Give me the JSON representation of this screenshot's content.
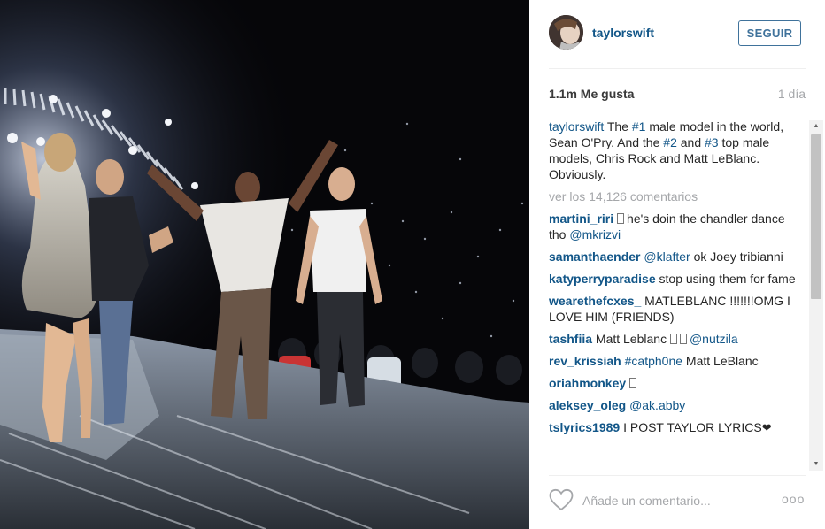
{
  "header": {
    "username": "taylorswift",
    "follow_label": "SEGUIR"
  },
  "stats": {
    "likes": "1.1m Me gusta",
    "time": "1 día"
  },
  "caption": {
    "user": "taylorswift",
    "t1": "The ",
    "tag1": "#1",
    "t2": " male model in the world, Sean O'Pry. And the ",
    "tag2": "#2",
    "t3": " and ",
    "tag3": "#3",
    "t4": " top male models, Chris Rock and Matt LeBlanc. Obviously."
  },
  "view_all": "ver los 14,126 comentarios",
  "comments": [
    {
      "user": "martini_riri",
      "text": "he's doin the chandler dance tho ",
      "tag": "@mkrizvi"
    },
    {
      "user": "samanthaender",
      "tag": "@klafter",
      "text": " ok Joey tribianni"
    },
    {
      "user": "katyperryparadise",
      "text": " stop using them for fame"
    },
    {
      "user": "wearethefcxes_",
      "text": " MATLEBLANC !!!!!!!OMG I LOVE HIM (FRIENDS)"
    },
    {
      "user": "tashfiia",
      "text": " Matt Leblanc ",
      "tag": "@nutzila"
    },
    {
      "user": "rev_krissiah",
      "tag": "#catph0ne",
      "text": " Matt LeBlanc"
    },
    {
      "user": "oriahmonkey"
    },
    {
      "user": "aleksey_oleg",
      "tag": "@ak.abby"
    },
    {
      "user": "tslyrics1989",
      "text": " I POST TAYLOR LYRICS",
      "heart": "❤"
    }
  ],
  "footer": {
    "placeholder": "Añade un comentario...",
    "more": "ooo"
  },
  "icons": {
    "heart": "heart-outline-icon",
    "more": "more-options-icon",
    "scroll_up": "scroll-up-arrow-icon",
    "scroll_down": "scroll-down-arrow-icon"
  },
  "colors": {
    "link": "#125688",
    "button": "#3f729b",
    "muted": "#a5a7aa",
    "text": "#262626"
  }
}
